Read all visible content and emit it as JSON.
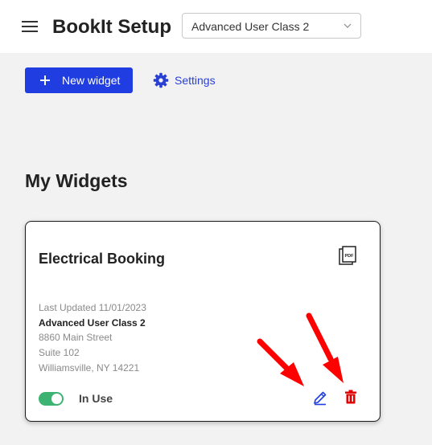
{
  "header": {
    "title": "BookIt Setup",
    "class_select": {
      "selected": "Advanced User Class 2"
    }
  },
  "toolbar": {
    "new_widget_label": "New widget",
    "settings_label": "Settings"
  },
  "section": {
    "title": "My Widgets"
  },
  "widget_card": {
    "title": "Electrical Booking",
    "last_updated": "Last Updated 11/01/2023",
    "class_name": "Advanced User Class 2",
    "address_line1": "8860 Main Street",
    "address_line2": "Suite 102",
    "address_line3": "Williamsville, NY 14221",
    "status_label": "In Use",
    "in_use": true,
    "icons": [
      "pdf-icon",
      "edit-icon",
      "delete-icon"
    ]
  },
  "colors": {
    "primary": "#1f3de0",
    "link": "#2940d3",
    "toggle_on": "#3cb371",
    "delete": "#e00000",
    "annotation_arrow": "#ff0000"
  }
}
